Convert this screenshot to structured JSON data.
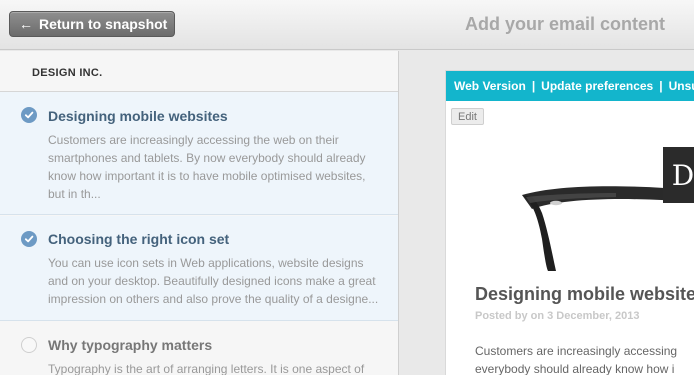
{
  "topbar": {
    "return_label": "Return to snapshot",
    "heading": "Add your email content"
  },
  "sidebar": {
    "company": "DESIGN INC.",
    "articles": [
      {
        "title": "Designing mobile websites",
        "excerpt_lines": [
          "Customers are increasingly accessing the web on their",
          "smartphones and tablets. By now everybody should already",
          "know how important it is to have mobile optimised websites,",
          "but in th..."
        ],
        "selected": true
      },
      {
        "title": "Choosing the right icon set",
        "excerpt_lines": [
          "You can use icon sets in Web applications, website designs",
          "and on your desktop. Beautifully designed icons make a great",
          "impression on others and also prove the quality of a designe..."
        ],
        "selected": true
      },
      {
        "title": "Why typography matters",
        "excerpt_lines": [
          "Typography is the art of arranging letters. It is one aspect of"
        ],
        "selected": false
      }
    ]
  },
  "preview": {
    "nav": {
      "web_version": "Web Version",
      "separator": "|",
      "update_preferences": "Update preferences",
      "unsubscribe_partial": "Unsu"
    },
    "edit_label": "Edit",
    "badge_letter": "D",
    "post_title": "Designing mobile websites",
    "post_meta": "Posted by on 3 December, 2013",
    "excerpt_lines": [
      "Customers are increasingly accessing",
      "everybody should already know how i"
    ]
  },
  "colors": {
    "accent_cyan": "#13b5cc",
    "check_blue": "#6d9ac4",
    "title_blue": "#44627c",
    "selected_bg": "#eef5fb"
  }
}
